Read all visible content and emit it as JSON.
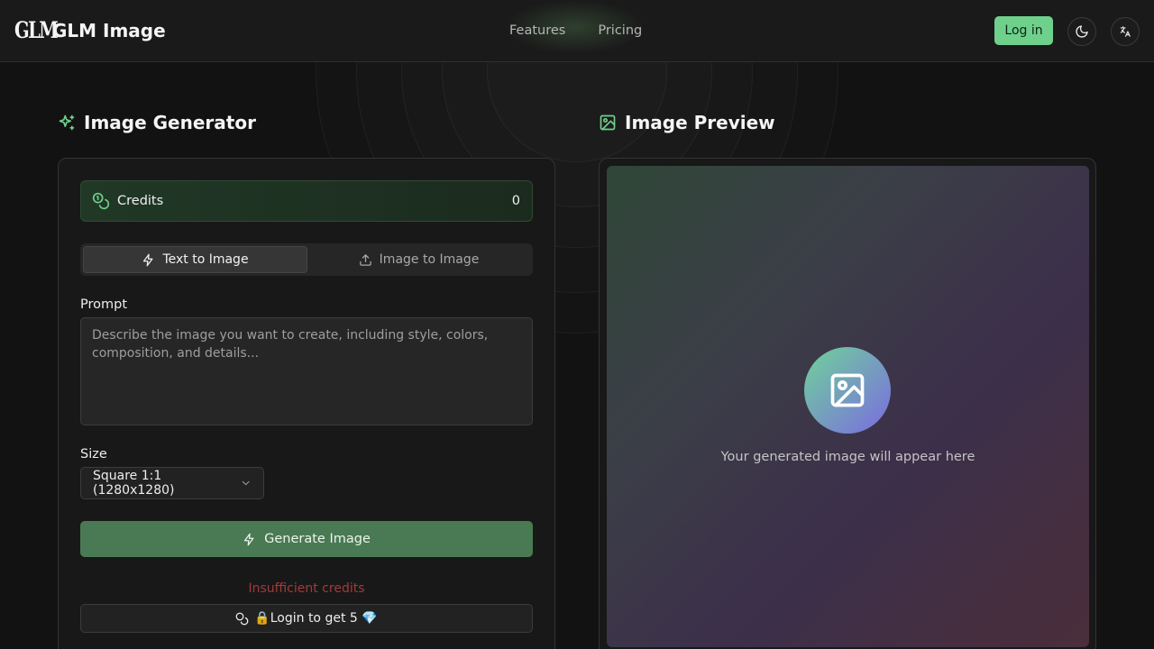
{
  "header": {
    "brand": "GLM Image",
    "logo_mark": "GLM",
    "nav": [
      "Features",
      "Pricing"
    ],
    "login_label": "Log in",
    "theme_icon": "moon-icon",
    "lang_icon": "translate-icon"
  },
  "generator": {
    "title": "Image Generator",
    "credits_label": "Credits",
    "credits_value": "0",
    "tabs": [
      {
        "label": "Text to Image",
        "icon": "zap-icon",
        "active": true
      },
      {
        "label": "Image to Image",
        "icon": "upload-icon",
        "active": false
      }
    ],
    "prompt_label": "Prompt",
    "prompt_placeholder": "Describe the image you want to create, including style, colors, composition, and details...",
    "size_label": "Size",
    "size_value": "Square 1:1 (1280x1280)",
    "generate_label": "Generate Image",
    "insufficient_text": "Insufficient credits",
    "login_get_text": "🔒Login to get 5 💎"
  },
  "preview": {
    "title": "Image Preview",
    "placeholder_text": "Your generated image will appear here"
  },
  "colors": {
    "accent": "#6fd08c",
    "generate_bg": "#4a7a53",
    "error": "#a33a3a"
  }
}
